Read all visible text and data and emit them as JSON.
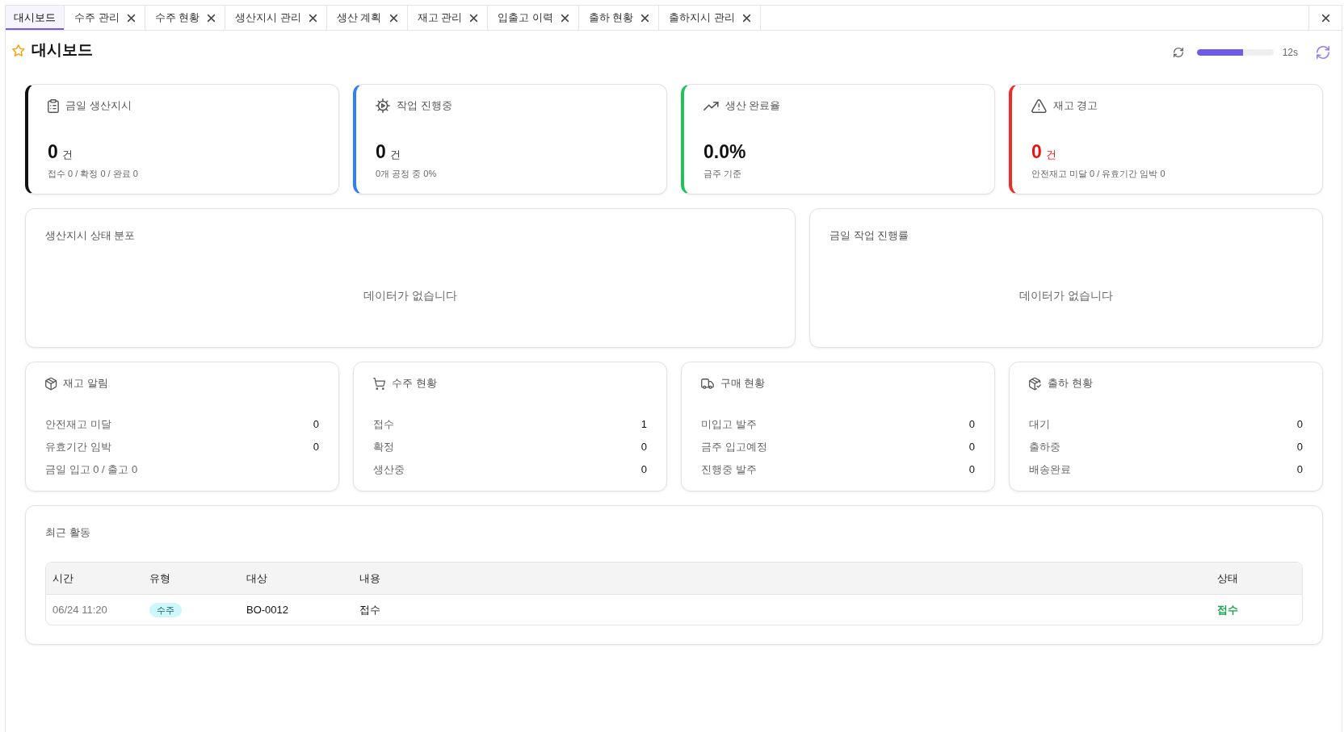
{
  "tabs": [
    {
      "label": "대시보드",
      "selected": true,
      "closable": false
    },
    {
      "label": "수주 관리",
      "selected": false,
      "closable": true
    },
    {
      "label": "수주 현황",
      "selected": false,
      "closable": true
    },
    {
      "label": "생산지시 관리",
      "selected": false,
      "closable": true
    },
    {
      "label": "생산 계획",
      "selected": false,
      "closable": true
    },
    {
      "label": "재고 관리",
      "selected": false,
      "closable": true
    },
    {
      "label": "입출고 이력",
      "selected": false,
      "closable": true
    },
    {
      "label": "출하 현황",
      "selected": false,
      "closable": true
    },
    {
      "label": "출하지시 관리",
      "selected": false,
      "closable": true
    }
  ],
  "page": {
    "title": "대시보드"
  },
  "auto_refresh": {
    "level": 0.6,
    "countdown": "12s"
  },
  "kpi_cards": [
    {
      "title": "금일 생산지시",
      "value": "0",
      "unit": "건",
      "detail": "접수 0 / 확정 0 / 완료 0",
      "color": "#111111",
      "alert": false
    },
    {
      "title": "작업 진행중",
      "value": "0",
      "unit": "건",
      "detail": "0개 공정 중 0%",
      "color": "#2f7ff7",
      "alert": false
    },
    {
      "title": "생산 완료율",
      "value": "0.0%",
      "detail": "금주 기준",
      "color": "#1fc25a",
      "alert": false
    },
    {
      "title": "재고 경고",
      "value": "0",
      "unit": "건",
      "detail": "안전재고 미달 0 / 유효기간 임박 0",
      "color": "#ee2b2b",
      "alert": true
    }
  ],
  "chart_panels": [
    {
      "title": "생산지시 상태 분포",
      "empty_message": "데이터가 없습니다"
    },
    {
      "title": "금일 작업 진행률",
      "empty_message": "데이터가 없습니다"
    }
  ],
  "summary_cards": [
    {
      "title": "재고 알림",
      "rows": [
        {
          "label": "안전재고 미달",
          "value": "0"
        },
        {
          "label": "유효기간 임박",
          "value": "0"
        },
        {
          "label": "금일 입고 0 / 출고 0"
        }
      ]
    },
    {
      "title": "수주 현황",
      "rows": [
        {
          "label": "접수",
          "value": "1"
        },
        {
          "label": "확정",
          "value": "0"
        },
        {
          "label": "생산중",
          "value": "0"
        }
      ]
    },
    {
      "title": "구매 현황",
      "rows": [
        {
          "label": "미입고 발주",
          "value": "0"
        },
        {
          "label": "금주 입고예정",
          "value": "0"
        },
        {
          "label": "진행중 발주",
          "value": "0"
        }
      ]
    },
    {
      "title": "출하 현황",
      "rows": [
        {
          "label": "대기",
          "value": "0"
        },
        {
          "label": "출하중",
          "value": "0"
        },
        {
          "label": "배송완료",
          "value": "0"
        }
      ]
    }
  ],
  "recent_activity": {
    "title": "최근 활동",
    "columns": [
      "시간",
      "유형",
      "대상",
      "내용",
      "상태"
    ],
    "rows": [
      {
        "time": "06/24 11:20",
        "type": "수주",
        "target": "BO-0012",
        "content": "접수",
        "status": "접수"
      }
    ]
  }
}
